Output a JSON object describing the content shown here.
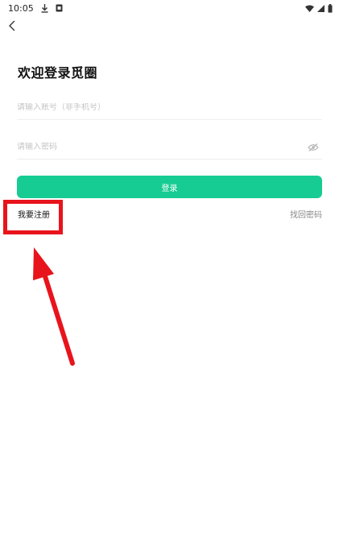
{
  "status_bar": {
    "time": "10:05",
    "icons": [
      "download-icon",
      "notification-icon",
      "wifi-icon",
      "signal-icon",
      "battery-icon"
    ]
  },
  "nav": {
    "back_icon": "chevron-left-icon"
  },
  "login": {
    "title": "欢迎登录觅圈",
    "account_placeholder": "请输入账号（非手机号）",
    "password_placeholder": "请输入密码",
    "login_label": "登录",
    "register_label": "我要注册",
    "forgot_label": "找回密码"
  },
  "colors": {
    "accent": "#16cc93",
    "annotation": "#e8141c",
    "placeholder": "#c4c4c4"
  }
}
